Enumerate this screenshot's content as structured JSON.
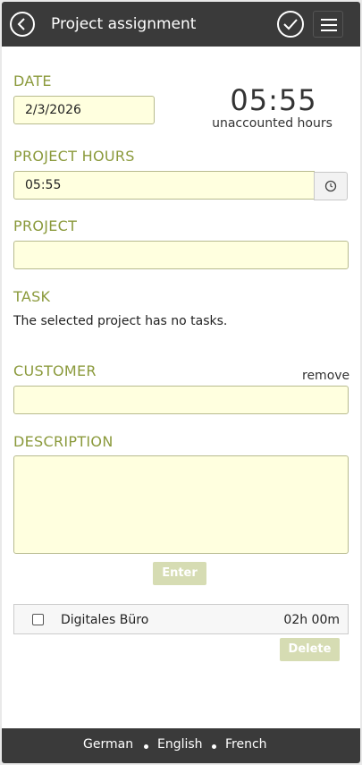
{
  "header": {
    "title": "Project assignment",
    "back_icon": "chevron-left-circle-icon",
    "confirm_icon": "check-circle-icon",
    "menu_icon": "hamburger-menu-icon"
  },
  "date": {
    "label": "DATE",
    "value": "2/3/2026"
  },
  "summary": {
    "time": "05:55",
    "caption": "unaccounted hours"
  },
  "project_hours": {
    "label": "PROJECT HOURS",
    "value": "05:55",
    "picker_icon": "clock-icon"
  },
  "project": {
    "label": "PROJECT",
    "value": ""
  },
  "task": {
    "label": "TASK",
    "message": "The selected project has no tasks."
  },
  "customer": {
    "label": "CUSTOMER",
    "remove_label": "remove",
    "value": ""
  },
  "description": {
    "label": "DESCRIPTION",
    "value": ""
  },
  "enter_button": "Enter",
  "entries": [
    {
      "name": "Digitales Büro",
      "hours": "02h 00m",
      "checked": false
    }
  ],
  "delete_button": "Delete",
  "footer": {
    "languages": [
      "German",
      "English",
      "French"
    ]
  },
  "colors": {
    "header_bg": "#3a3a3a",
    "label": "#8b9a3c",
    "input_bg": "#ffffdf",
    "disabled_button": "#d6dcb3"
  }
}
